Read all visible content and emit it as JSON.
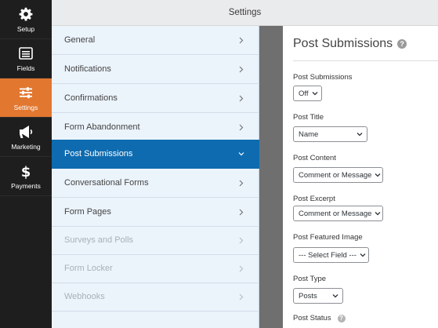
{
  "sidebar": {
    "items": [
      {
        "label": "Setup",
        "icon": "gear-icon"
      },
      {
        "label": "Fields",
        "icon": "fields-list-icon"
      },
      {
        "label": "Settings",
        "icon": "sliders-icon",
        "active": true
      },
      {
        "label": "Marketing",
        "icon": "megaphone-icon"
      },
      {
        "label": "Payments",
        "icon": "dollar-icon"
      }
    ]
  },
  "header": {
    "title": "Settings"
  },
  "settings_menu": {
    "items": [
      {
        "label": "General"
      },
      {
        "label": "Notifications"
      },
      {
        "label": "Confirmations"
      },
      {
        "label": "Form Abandonment"
      },
      {
        "label": "Post Submissions",
        "active": true
      },
      {
        "label": "Conversational Forms"
      },
      {
        "label": "Form Pages"
      },
      {
        "label": "Surveys and Polls",
        "disabled": true
      },
      {
        "label": "Form Locker",
        "disabled": true
      },
      {
        "label": "Webhooks",
        "disabled": true
      }
    ]
  },
  "panel": {
    "title": "Post Submissions",
    "fields": [
      {
        "label": "Post Submissions",
        "value": "Off"
      },
      {
        "label": "Post Title",
        "value": "Name"
      },
      {
        "label": "Post Content",
        "value": "Comment or Message"
      },
      {
        "label": "Post Excerpt",
        "value": "Comment or Message"
      },
      {
        "label": "Post Featured Image",
        "value": "--- Select Field ---"
      },
      {
        "label": "Post Type",
        "value": "Posts"
      },
      {
        "label": "Post Status",
        "value": ""
      }
    ]
  },
  "colors": {
    "sidebar_bg": "#1e1e1e",
    "sidebar_active": "#e27730",
    "menu_bg": "#ebf3fb",
    "menu_active": "#0e6bb0"
  }
}
